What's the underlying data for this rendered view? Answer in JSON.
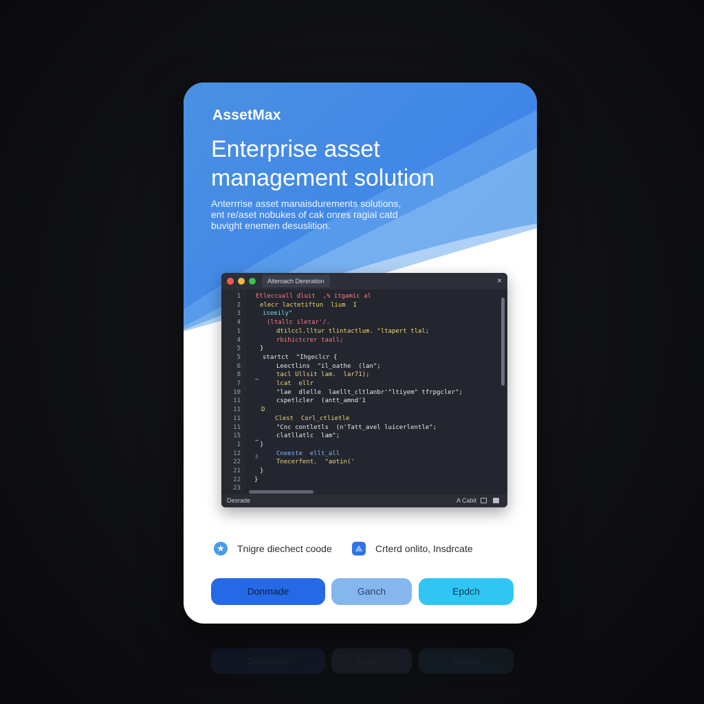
{
  "brand": "AssetMax",
  "hero": {
    "headline_line1": "Enterprise asset",
    "headline_line2": "management solution",
    "sub_line1": "Anterrrise asset manaisdurements solutions,",
    "sub_line2": "ent re/aset nobukes of cak onres ragial catd",
    "sub_line3": "buvight enemen desuslition."
  },
  "code_window": {
    "tab_title": "Alteroach Dereration",
    "close": "×",
    "status_left": "Desrade",
    "status_right": "A Cabit",
    "lines": [
      {
        "num": "1",
        "text": "Etleccuall dluit  ,% itgamic al",
        "color": "c-red",
        "indent": 50
      },
      {
        "num": "2",
        "text": "elecr lactetiftun  lium  I",
        "color": "c-yel",
        "indent": 56
      },
      {
        "num": "3",
        "text": "iseeily\"",
        "color": "c-cyan",
        "indent": 60
      },
      {
        "num": "4",
        "text": "(ltallc iletar'/.",
        "color": "c-red",
        "indent": 66
      },
      {
        "num": "1",
        "text": "dtilccl.lltur tlintactlum. \"ltapert tlal;",
        "color": "c-yel",
        "indent": 80
      },
      {
        "num": "4",
        "text": "rbihictcrer taall;",
        "color": "c-red",
        "indent": 80
      },
      {
        "num": "5",
        "text": "}",
        "color": "c-wht",
        "indent": 56
      },
      {
        "num": "5",
        "text": "startct  \"Ihgeclcr {",
        "color": "c-wht",
        "indent": 60
      },
      {
        "num": "6",
        "text": "Leectlins  \"il_oathe  (lan\";",
        "color": "c-wht",
        "indent": 80
      },
      {
        "num": "8",
        "text": "tacl Ullsit lam.  lar71);",
        "color": "c-yel",
        "indent": 80
      },
      {
        "num": "7",
        "text": "lcat  ellr",
        "color": "c-yel",
        "indent": 80
      },
      {
        "num": "10",
        "text": "\"lae  dlelle  laellt_cltlanbr'\"ltiyem\" tfrpgcler\";",
        "color": "c-wht",
        "indent": 80
      },
      {
        "num": "11",
        "text": "cspetlcler  (antt_amnd'1",
        "color": "c-wht",
        "indent": 80
      },
      {
        "num": "11",
        "text": "D",
        "color": "c-yel",
        "indent": 58
      },
      {
        "num": "11",
        "text": "Clest  Corl_ctlietle",
        "color": "c-yel",
        "indent": 78
      },
      {
        "num": "11",
        "text": "\"Cnc contletls  (n'Tatt_avel luicerlentle\";",
        "color": "c-wht",
        "indent": 80
      },
      {
        "num": "15",
        "text": "clatllatlc  lam\";",
        "color": "c-wht",
        "indent": 80
      },
      {
        "num": "1",
        "text": "}",
        "color": "c-wht",
        "indent": 56
      },
      {
        "num": "12",
        "text": "Cneeste  ellt_all",
        "color": "c-blu",
        "indent": 80
      },
      {
        "num": "22",
        "text": "Tnecerfent.  \"aotin('",
        "color": "c-yel",
        "indent": 80
      },
      {
        "num": "21",
        "text": "}",
        "color": "c-wht",
        "indent": 56
      },
      {
        "num": "22",
        "text": "}",
        "color": "c-wht",
        "indent": 48
      },
      {
        "num": "23",
        "text": "",
        "color": "c-wht",
        "indent": 48
      }
    ]
  },
  "features": {
    "item1": {
      "label": "Tnigre diechect coode",
      "icon": "star-badge-icon"
    },
    "item2": {
      "label": "Crterd onlito, Insdrcate",
      "icon": "triangle-nodes-icon"
    }
  },
  "buttons": {
    "primary": "Donmade",
    "secondary": "Ganch",
    "tertiary": "Epdch"
  },
  "colors": {
    "hero_blue": "#3f86e8",
    "primary_button": "#2569e6",
    "secondary_button": "#86b6ee",
    "tertiary_button": "#30c5f3",
    "editor_bg": "#23262e"
  }
}
